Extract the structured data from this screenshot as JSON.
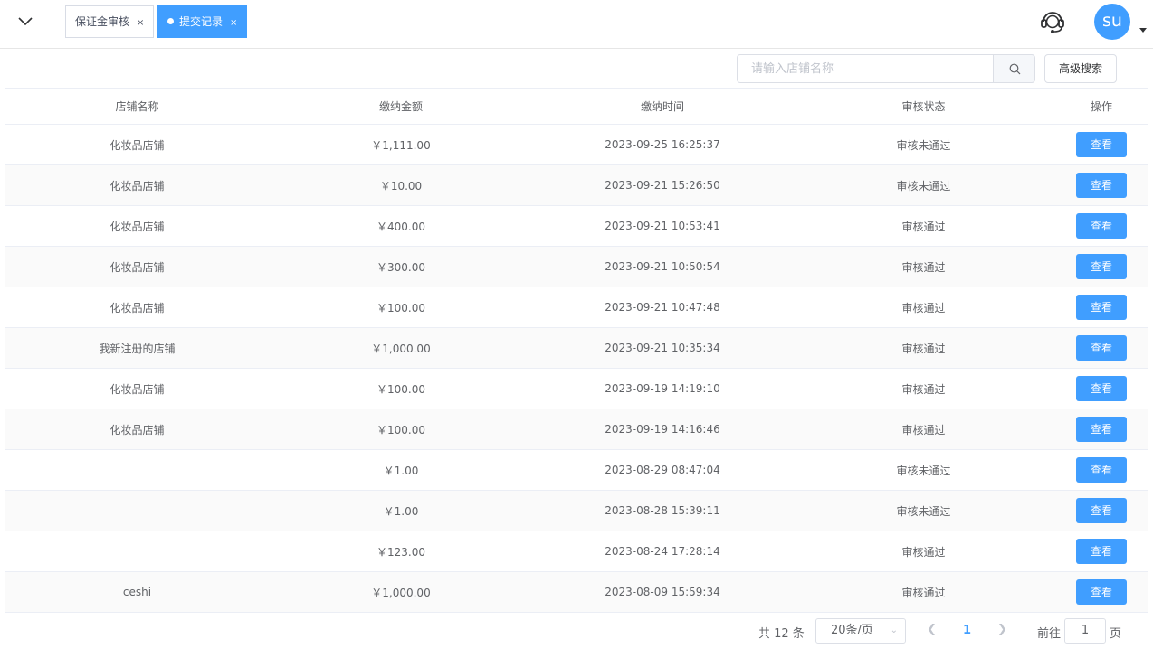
{
  "header": {
    "tabs": [
      {
        "label": "保证金审核",
        "close": "×",
        "active": false
      },
      {
        "label": "提交记录",
        "close": "×",
        "active": true
      }
    ],
    "avatar_text": "su"
  },
  "toolbar": {
    "search_placeholder": "请输入店铺名称",
    "advanced_search_label": "高级搜索"
  },
  "table": {
    "columns": [
      "店铺名称",
      "缴纳金额",
      "缴纳时间",
      "审核状态",
      "操作"
    ],
    "rows": [
      {
        "shop": "化妆品店铺",
        "amount": "￥1,111.00",
        "time": "2023-09-25 16:25:37",
        "status": "审核未通过",
        "action": "查看"
      },
      {
        "shop": "化妆品店铺",
        "amount": "￥10.00",
        "time": "2023-09-21 15:26:50",
        "status": "审核未通过",
        "action": "查看"
      },
      {
        "shop": "化妆品店铺",
        "amount": "￥400.00",
        "time": "2023-09-21 10:53:41",
        "status": "审核通过",
        "action": "查看"
      },
      {
        "shop": "化妆品店铺",
        "amount": "￥300.00",
        "time": "2023-09-21 10:50:54",
        "status": "审核通过",
        "action": "查看"
      },
      {
        "shop": "化妆品店铺",
        "amount": "￥100.00",
        "time": "2023-09-21 10:47:48",
        "status": "审核通过",
        "action": "查看"
      },
      {
        "shop": "我新注册的店铺",
        "amount": "￥1,000.00",
        "time": "2023-09-21 10:35:34",
        "status": "审核通过",
        "action": "查看"
      },
      {
        "shop": "化妆品店铺",
        "amount": "￥100.00",
        "time": "2023-09-19 14:19:10",
        "status": "审核通过",
        "action": "查看"
      },
      {
        "shop": "化妆品店铺",
        "amount": "￥100.00",
        "time": "2023-09-19 14:16:46",
        "status": "审核通过",
        "action": "查看"
      },
      {
        "shop": "",
        "amount": "￥1.00",
        "time": "2023-08-29 08:47:04",
        "status": "审核未通过",
        "action": "查看"
      },
      {
        "shop": "",
        "amount": "￥1.00",
        "time": "2023-08-28 15:39:11",
        "status": "审核未通过",
        "action": "查看"
      },
      {
        "shop": "",
        "amount": "￥123.00",
        "time": "2023-08-24 17:28:14",
        "status": "审核通过",
        "action": "查看"
      },
      {
        "shop": "ceshi",
        "amount": "￥1,000.00",
        "time": "2023-08-09 15:59:34",
        "status": "审核通过",
        "action": "查看"
      }
    ]
  },
  "pagination": {
    "total_text": "共 12 条",
    "page_size": "20条/页",
    "current_page": "1",
    "goto_label": "前往",
    "goto_value": "1",
    "page_unit": "页"
  },
  "colors": {
    "primary": "#409eff",
    "border": "#ebeef5"
  }
}
